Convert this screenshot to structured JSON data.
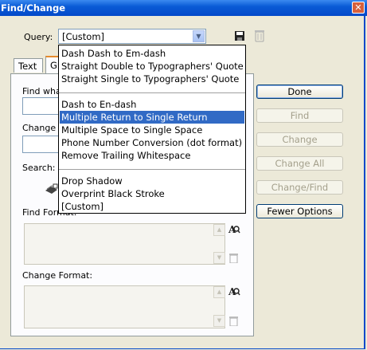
{
  "window": {
    "title": "Find/Change",
    "close_glyph": "✕"
  },
  "query": {
    "label": "Query:",
    "value": "[Custom]",
    "options": [
      "Dash Dash to Em-dash",
      "Straight Double to Typographers' Quote",
      "Straight Single to Typographers' Quote",
      "",
      "Dash to En-dash",
      "Multiple Return to Single Return",
      "Multiple Space to Single Space",
      "Phone Number Conversion (dot format)",
      "Remove Trailing Whitespace",
      "",
      "Drop Shadow",
      "Overprint Black Stroke",
      "[Custom]"
    ],
    "highlighted": "Multiple Return to Single Return"
  },
  "tabs": [
    "Text",
    "Gr"
  ],
  "form": {
    "find_what_label": "Find what:",
    "change_to_label": "Change",
    "search_label": "Search:",
    "find_format_label": "Find Format:",
    "change_format_label": "Change Format:"
  },
  "buttons": {
    "done": "Done",
    "find": "Find",
    "change": "Change",
    "change_all": "Change All",
    "change_find": "Change/Find",
    "fewer_options": "Fewer Options"
  }
}
